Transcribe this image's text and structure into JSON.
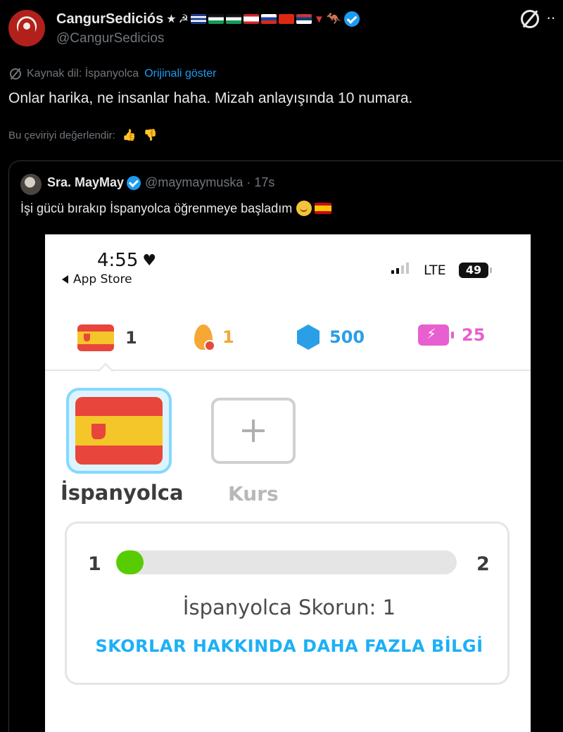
{
  "tweet": {
    "display_name": "CangurSediciós",
    "name_emoji": [
      "star",
      "flag",
      "flag",
      "flag",
      "flag",
      "flag",
      "flag",
      "flag",
      "heart",
      "kangaroo"
    ],
    "handle": "@CangurSedicios",
    "translate_prefix": "Kaynak dil: İspanyolca",
    "show_original": "Orijinali göster",
    "text": "Onlar harika, ne insanlar haha. Mizah anlayışında 10 numara.",
    "rate_prompt": "Bu çeviriyi değerlendir:"
  },
  "quote": {
    "display_name": "Sra. MayMay",
    "handle_time": "@maymaymuska · 17s",
    "text": "İşi gücü bırakıp İspanyolca öğrenmeye başladım"
  },
  "phone": {
    "time": "4:55",
    "back_app": "App Store",
    "network": "LTE",
    "battery": "49",
    "stats": {
      "courses": "1",
      "streak": "1",
      "gems": "500",
      "energy": "25"
    },
    "course_label": "İspanyolca",
    "add_label": "Kurs",
    "score": {
      "level_from": "1",
      "level_to": "2",
      "progress": 0.05,
      "text": "İspanyolca Skorun: 1",
      "link": "SKORLAR HAKKINDA DAHA FAZLA BİLGİ"
    }
  },
  "colors": {
    "accent": "#1d9bf0",
    "duo_green": "#58cc02",
    "duo_blue": "#1cb0f6"
  }
}
